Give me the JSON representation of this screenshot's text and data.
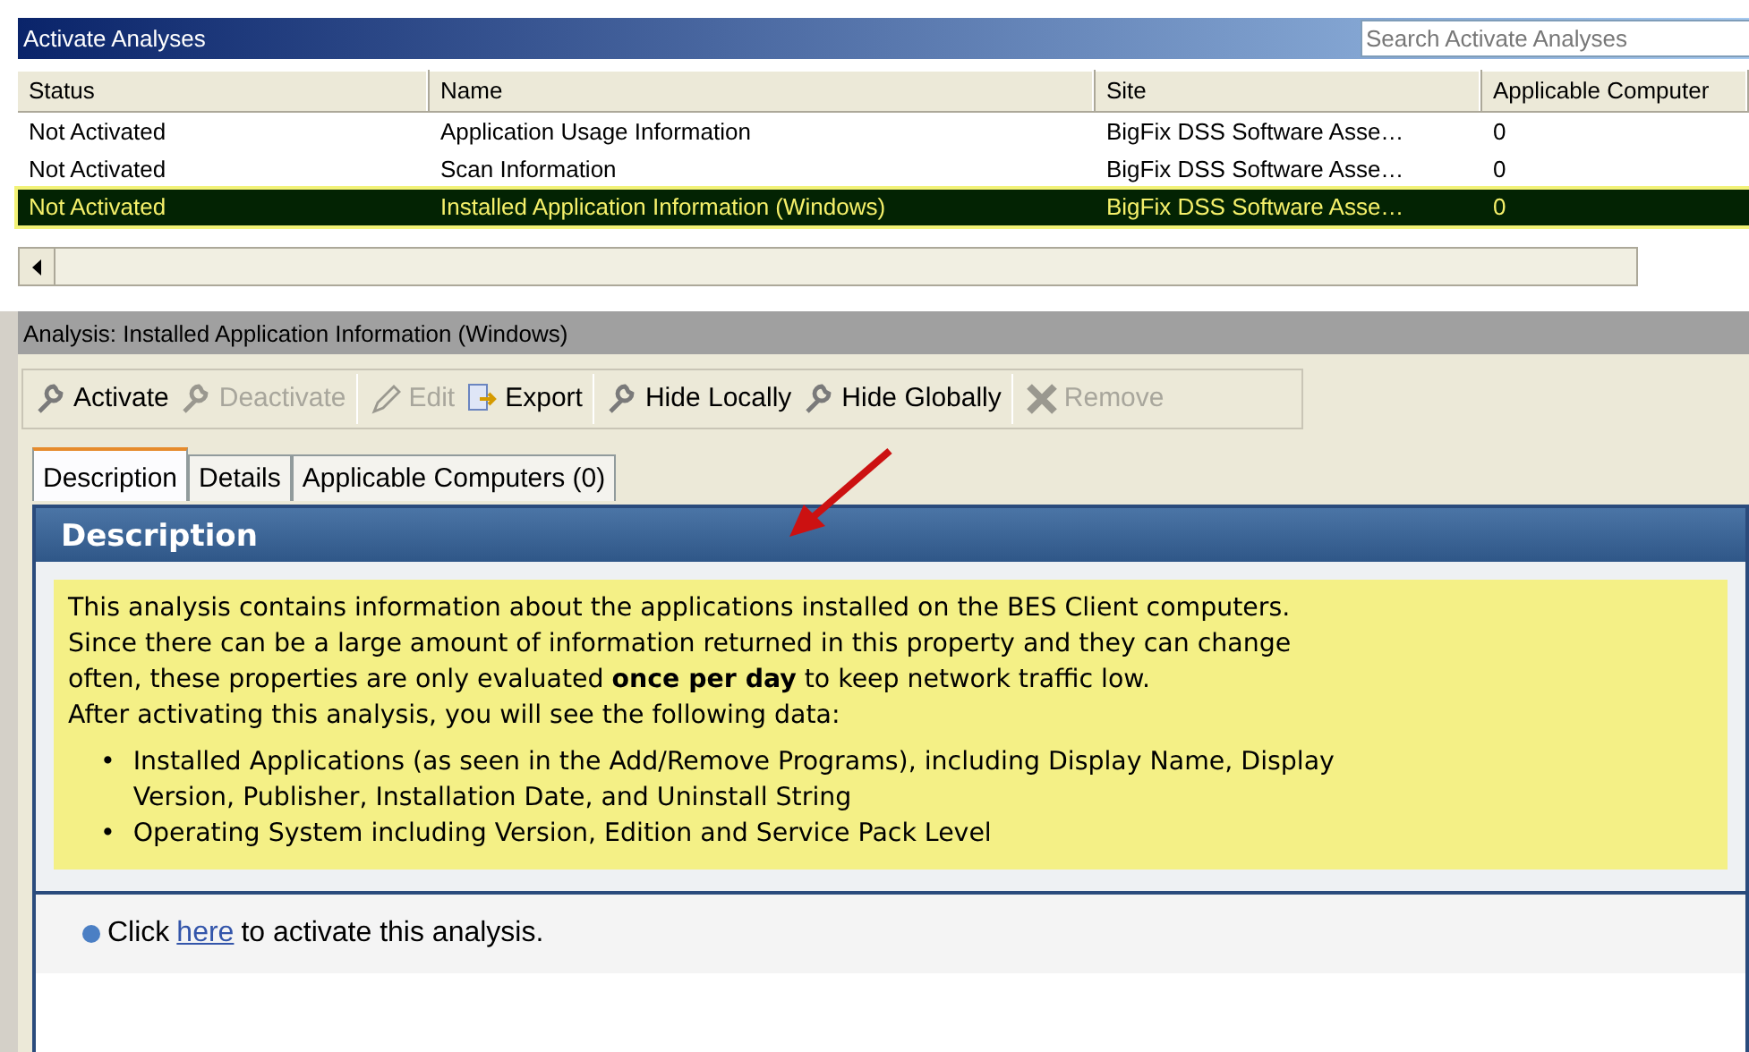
{
  "window": {
    "title": "Activate Analyses"
  },
  "search": {
    "placeholder": "Search Activate Analyses"
  },
  "table": {
    "columns": [
      "Status",
      "Name",
      "Site",
      "Applicable Computer"
    ],
    "rows": [
      {
        "cells": [
          "Not Activated",
          "Application Usage Information",
          "BigFix DSS Software Asse…",
          "0"
        ],
        "selected": false
      },
      {
        "cells": [
          "Not Activated",
          "Scan Information",
          "BigFix DSS Software Asse…",
          "0"
        ],
        "selected": false
      },
      {
        "cells": [
          "Not Activated",
          "Installed Application Information (Windows)",
          "BigFix DSS Software Asse…",
          "0"
        ],
        "selected": true
      }
    ]
  },
  "analysis_bar": {
    "title": "Analysis: Installed Application Information (Windows)"
  },
  "toolbar": [
    {
      "label": "Activate",
      "disabled": false
    },
    {
      "label": "Deactivate",
      "disabled": true
    },
    {
      "label": "Edit",
      "disabled": true
    },
    {
      "label": "Export",
      "disabled": false
    },
    {
      "label": "Hide Locally",
      "disabled": false
    },
    {
      "label": "Hide Globally",
      "disabled": false
    },
    {
      "label": "Remove",
      "disabled": true
    }
  ],
  "tabs": [
    {
      "label": "Description",
      "selected": true
    },
    {
      "label": "Details",
      "selected": false
    },
    {
      "label": "Applicable Computers (0)",
      "selected": false
    }
  ],
  "description": {
    "heading": "Description",
    "paragraph_lines": [
      "This analysis contains information about the applications installed on the BES Client computers.",
      "Since there can be a large amount of information returned in this property and they can change",
      "often, these properties are only evaluated **once per day** to keep network traffic low."
    ],
    "intro": "After activating this analysis, you will see the following data:",
    "bullets": [
      {
        "marker": "•",
        "lines": [
          "Installed Applications (as seen in the Add/Remove Programs), including Display Name, Display",
          "Version, Publisher, Installation Date, and Uninstall String"
        ]
      },
      {
        "marker": "•",
        "lines": [
          "Operating System including Version, Edition and Service Pack Level"
        ]
      }
    ],
    "action": {
      "before": "Click",
      "link": "here",
      "after": "to activate this analysis."
    }
  }
}
